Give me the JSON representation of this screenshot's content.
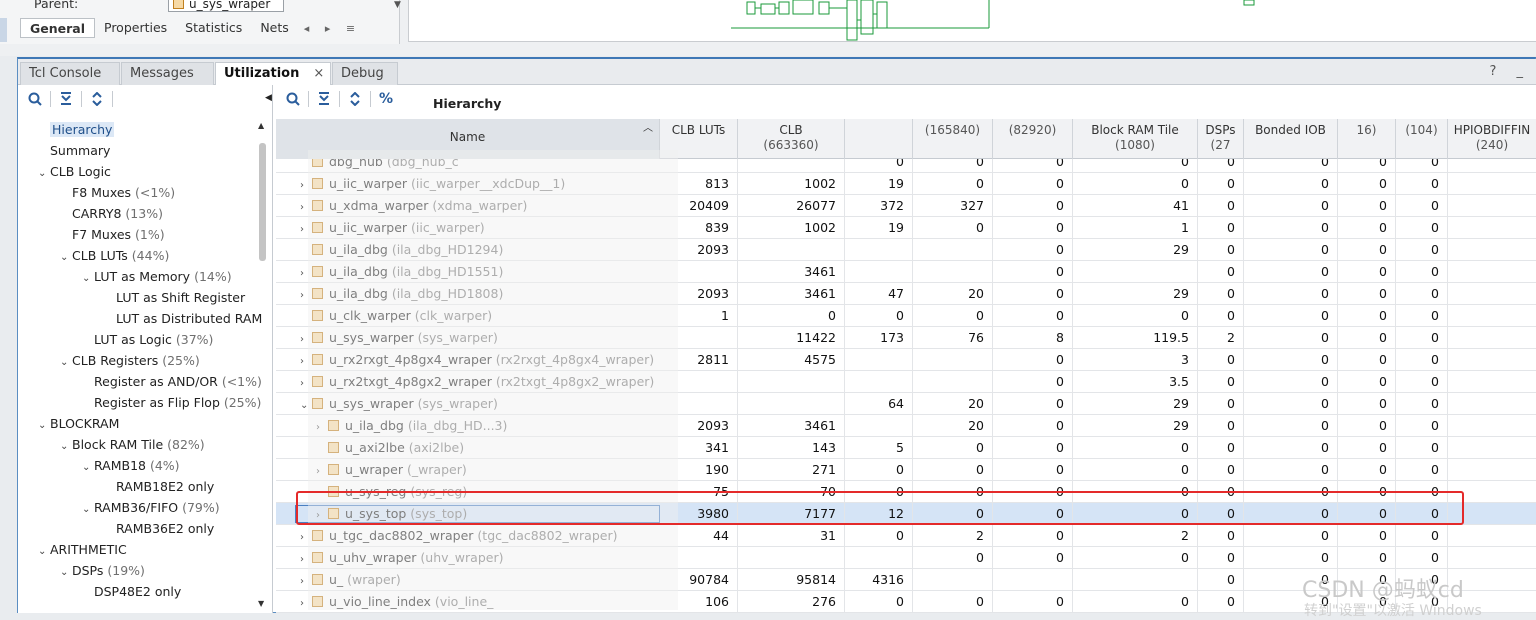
{
  "props": {
    "parent_label": "Parent:",
    "parent_value": "u_sys_wraper",
    "tabs": [
      "General",
      "Properties",
      "Statistics",
      "Nets"
    ],
    "nav": "◂ ▸ ≡"
  },
  "main_tabs": [
    {
      "label": "Tcl Console"
    },
    {
      "label": "Messages"
    },
    {
      "label": "Utilization",
      "close": "×"
    },
    {
      "label": "Debug"
    }
  ],
  "window_controls": "? _",
  "toolbar_icons": {
    "search": "🔍",
    "collapse": "⇟",
    "expand": "⇞",
    "percent": "%"
  },
  "right_title": "Hierarchy",
  "left_tree": [
    {
      "label": "Hierarchy",
      "pct": "",
      "exp": "",
      "selected": true
    },
    {
      "label": "Summary",
      "pct": "",
      "exp": ""
    },
    {
      "label": "CLB Logic",
      "pct": "",
      "exp": "v"
    },
    {
      "label": "F8 Muxes",
      "pct": " (<1%)",
      "exp": ""
    },
    {
      "label": "CARRY8",
      "pct": " (13%)",
      "exp": ""
    },
    {
      "label": "F7 Muxes",
      "pct": " (1%)",
      "exp": ""
    },
    {
      "label": "CLB LUTs",
      "pct": " (44%)",
      "exp": "v"
    },
    {
      "label": "LUT as Memory",
      "pct": " (14%)",
      "exp": "v"
    },
    {
      "label": "LUT as Shift Register",
      "pct": "",
      "exp": ""
    },
    {
      "label": "LUT as Distributed RAM",
      "pct": "",
      "exp": ""
    },
    {
      "label": "LUT as Logic",
      "pct": " (37%)",
      "exp": ""
    },
    {
      "label": "CLB Registers",
      "pct": " (25%)",
      "exp": "v"
    },
    {
      "label": "Register as AND/OR",
      "pct": " (<1%)",
      "exp": ""
    },
    {
      "label": "Register as Flip Flop",
      "pct": " (25%)",
      "exp": ""
    },
    {
      "label": "BLOCKRAM",
      "pct": "",
      "exp": "v"
    },
    {
      "label": "Block RAM Tile",
      "pct": " (82%)",
      "exp": "v"
    },
    {
      "label": "RAMB18",
      "pct": " (4%)",
      "exp": "v"
    },
    {
      "label": "RAMB18E2 only",
      "pct": "",
      "exp": ""
    },
    {
      "label": "RAMB36/FIFO",
      "pct": " (79%)",
      "exp": "v"
    },
    {
      "label": "RAMB36E2 only",
      "pct": "",
      "exp": ""
    },
    {
      "label": "ARITHMETIC",
      "pct": "",
      "exp": "v"
    },
    {
      "label": "DSPs",
      "pct": " (19%)",
      "exp": "v"
    },
    {
      "label": "DSP48E2 only",
      "pct": "",
      "exp": ""
    }
  ],
  "columns": [
    {
      "title": "Name",
      "sub": ""
    },
    {
      "title": "CLB LUTs",
      "sub": ""
    },
    {
      "title": "CLB",
      "sub": "(663360)"
    },
    {
      "title": "",
      "sub": ""
    },
    {
      "title": "",
      "sub": "(165840)"
    },
    {
      "title": "",
      "sub": "(82920)"
    },
    {
      "title": "Block RAM Tile",
      "sub": "(1080)"
    },
    {
      "title": "DSPs",
      "sub": "(27"
    },
    {
      "title": "Bonded IOB",
      "sub": ""
    },
    {
      "title": "",
      "sub": "16)"
    },
    {
      "title": "",
      "sub": "(104)"
    },
    {
      "title": "HPIOBDIFFIN",
      "sub": "(240)"
    }
  ],
  "rows": [
    {
      "chev": "",
      "name": "dbg_hub",
      "cls": " (dbg_hub_c",
      "v": [
        "",
        "",
        "0",
        "0",
        "0",
        "0",
        "0",
        "0",
        "0",
        "0"
      ]
    },
    {
      "chev": ">",
      "name": "u_iic_warper",
      "cls": " (iic_warper__xdcDup__1)",
      "v": [
        "813",
        "1002",
        "19",
        "0",
        "0",
        "0",
        "0",
        "0",
        "0",
        "0"
      ]
    },
    {
      "chev": ">",
      "name": "u_xdma_warper",
      "cls": " (xdma_warper)",
      "v": [
        "20409",
        "26077",
        "372",
        "327",
        "0",
        "41",
        "0",
        "0",
        "0",
        "0"
      ]
    },
    {
      "chev": ">",
      "name": "u_iic_warper",
      "cls": " (iic_warper)",
      "v": [
        "839",
        "1002",
        "19",
        "0",
        "0",
        "1",
        "0",
        "0",
        "0",
        "0"
      ]
    },
    {
      "chev": "",
      "name": "u_ila_dbg",
      "cls": " (ila_dbg_HD1294)",
      "v": [
        "2093",
        "",
        "",
        "",
        "0",
        "29",
        "0",
        "0",
        "0",
        "0"
      ]
    },
    {
      "chev": ">",
      "name": "u_ila_dbg",
      "cls": " (ila_dbg_HD1551)",
      "v": [
        "",
        "3461",
        "",
        "",
        "0",
        "",
        "0",
        "0",
        "0",
        "0"
      ]
    },
    {
      "chev": ">",
      "name": "u_ila_dbg",
      "cls": " (ila_dbg_HD1808)",
      "v": [
        "2093",
        "3461",
        "47",
        "20",
        "0",
        "29",
        "0",
        "0",
        "0",
        "0"
      ]
    },
    {
      "chev": "",
      "name": "u_clk_warper",
      "cls": " (clk_warper)",
      "v": [
        "1",
        "0",
        "0",
        "0",
        "0",
        "0",
        "0",
        "0",
        "0",
        "0"
      ]
    },
    {
      "chev": ">",
      "name": "u_sys_warper",
      "cls": " (sys_warper)",
      "v": [
        "",
        "11422",
        "173",
        "76",
        "8",
        "119.5",
        "2",
        "0",
        "0",
        "0"
      ]
    },
    {
      "chev": ">",
      "name": "u_rx2rxgt_4p8gx4_wraper",
      "cls": " (rx2rxgt_4p8gx4_wraper)",
      "v": [
        "2811",
        "4575",
        "",
        "",
        "0",
        "3",
        "0",
        "0",
        "0",
        "0"
      ]
    },
    {
      "chev": ">",
      "name": "u_rx2txgt_4p8gx2_wraper",
      "cls": " (rx2txgt_4p8gx2_wraper)",
      "v": [
        "",
        "",
        "",
        "",
        "0",
        "3.5",
        "0",
        "0",
        "0",
        "0"
      ]
    },
    {
      "chev": "v",
      "name": "u_sys_wraper",
      "cls": " (sys_wraper)",
      "v": [
        "",
        "",
        "64",
        "20",
        "0",
        "29",
        "0",
        "0",
        "0",
        "0"
      ]
    },
    {
      "chev": ">",
      "name": "u_ila_dbg",
      "cls": " (ila_dbg_HD...3)",
      "v": [
        "2093",
        "3461",
        "",
        "20",
        "0",
        "29",
        "0",
        "0",
        "0",
        "0"
      ]
    },
    {
      "chev": "",
      "name": "u_axi2lbe",
      "cls": " (axi2lbe)",
      "v": [
        "341",
        "143",
        "5",
        "0",
        "0",
        "0",
        "0",
        "0",
        "0",
        "0"
      ]
    },
    {
      "chev": ">",
      "name": "u_wraper",
      "cls": " (_wraper)",
      "v": [
        "190",
        "271",
        "0",
        "0",
        "0",
        "0",
        "0",
        "0",
        "0",
        "0"
      ]
    },
    {
      "chev": "",
      "name": "u_sys_reg",
      "cls": " (sys_reg)",
      "v": [
        "75",
        "70",
        "0",
        "0",
        "0",
        "0",
        "0",
        "0",
        "0",
        "0"
      ]
    },
    {
      "chev": ">",
      "name": "u_sys_top",
      "cls": " (sys_top)",
      "v": [
        "3980",
        "7177",
        "12",
        "0",
        "0",
        "0",
        "0",
        "0",
        "0",
        "0"
      ],
      "selected": true
    },
    {
      "chev": ">",
      "name": "u_tgc_dac8802_wraper",
      "cls": " (tgc_dac8802_wraper)",
      "v": [
        "44",
        "31",
        "0",
        "2",
        "0",
        "2",
        "0",
        "0",
        "0",
        "0"
      ]
    },
    {
      "chev": ">",
      "name": "u_uhv_wraper",
      "cls": " (uhv_wraper)",
      "v": [
        "",
        "",
        "",
        "0",
        "0",
        "0",
        "0",
        "0",
        "0",
        "0"
      ]
    },
    {
      "chev": ">",
      "name": "u_",
      "cls": " (wraper)",
      "v": [
        "90784",
        "95814",
        "4316",
        "",
        "",
        "",
        "0",
        "0",
        "0",
        "0"
      ]
    },
    {
      "chev": ">",
      "name": "u_vio_line_index",
      "cls": " (vio_line_",
      "v": [
        "106",
        "276",
        "0",
        "0",
        "0",
        "0",
        "0",
        "0",
        "0",
        "0"
      ]
    }
  ],
  "watermark": "CSDN @蚂蚁cd",
  "activation": "转到\"设置\"以激活 Windows"
}
